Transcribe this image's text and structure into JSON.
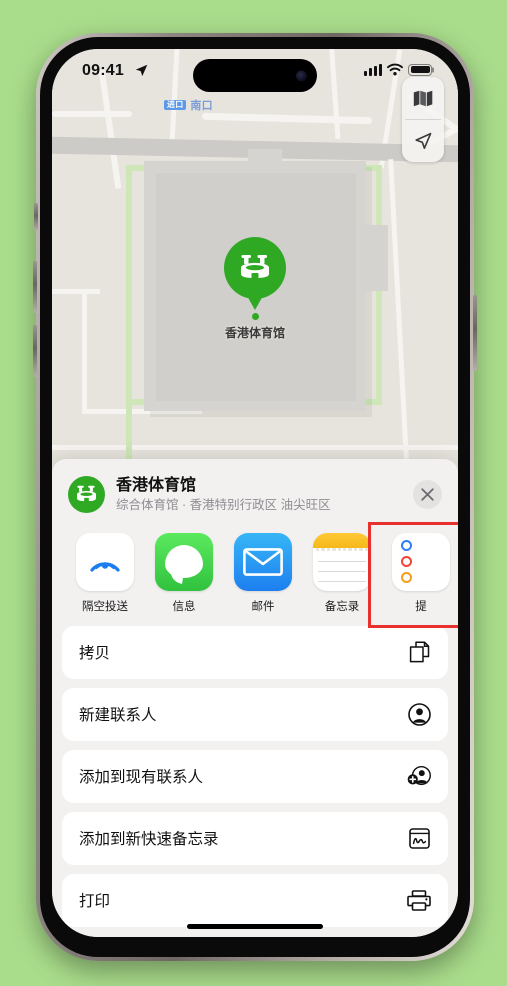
{
  "status_bar": {
    "time": "09:41",
    "location_arrow_icon": "location-arrow-icon",
    "signal_icon": "cellular-signal-icon",
    "wifi_icon": "wifi-icon",
    "battery_icon": "battery-full-icon"
  },
  "map": {
    "label_badge": "进口",
    "label_text": "南口",
    "pin_label": "香港体育馆",
    "pin_icon": "stadium-icon",
    "controls": {
      "layers_icon": "map-layers-icon",
      "locate_icon": "navigation-arrow-icon"
    }
  },
  "share_sheet": {
    "place_icon": "stadium-icon",
    "title": "香港体育馆",
    "subtitle": "综合体育馆 · 香港特别行政区 油尖旺区",
    "close_icon": "close-icon",
    "apps": [
      {
        "label": "隔空投送",
        "icon": "airdrop-icon",
        "highlighted": false
      },
      {
        "label": "信息",
        "icon": "messages-icon",
        "highlighted": false
      },
      {
        "label": "邮件",
        "icon": "mail-icon",
        "highlighted": false
      },
      {
        "label": "备忘录",
        "icon": "notes-icon",
        "highlighted": true
      },
      {
        "label": "提",
        "icon": "reminders-icon",
        "highlighted": false
      }
    ],
    "actions": [
      {
        "label": "拷贝",
        "icon": "copy-icon"
      },
      {
        "label": "新建联系人",
        "icon": "person-circle-icon"
      },
      {
        "label": "添加到现有联系人",
        "icon": "person-add-icon"
      },
      {
        "label": "添加到新快速备忘录",
        "icon": "quick-note-icon"
      },
      {
        "label": "打印",
        "icon": "printer-icon"
      }
    ]
  },
  "colors": {
    "background": "#a9dd8b",
    "accent_green": "#2fa924",
    "highlight_red": "#e8312c",
    "sheet_bg": "#f2f1f0",
    "row_bg": "#ffffff"
  }
}
